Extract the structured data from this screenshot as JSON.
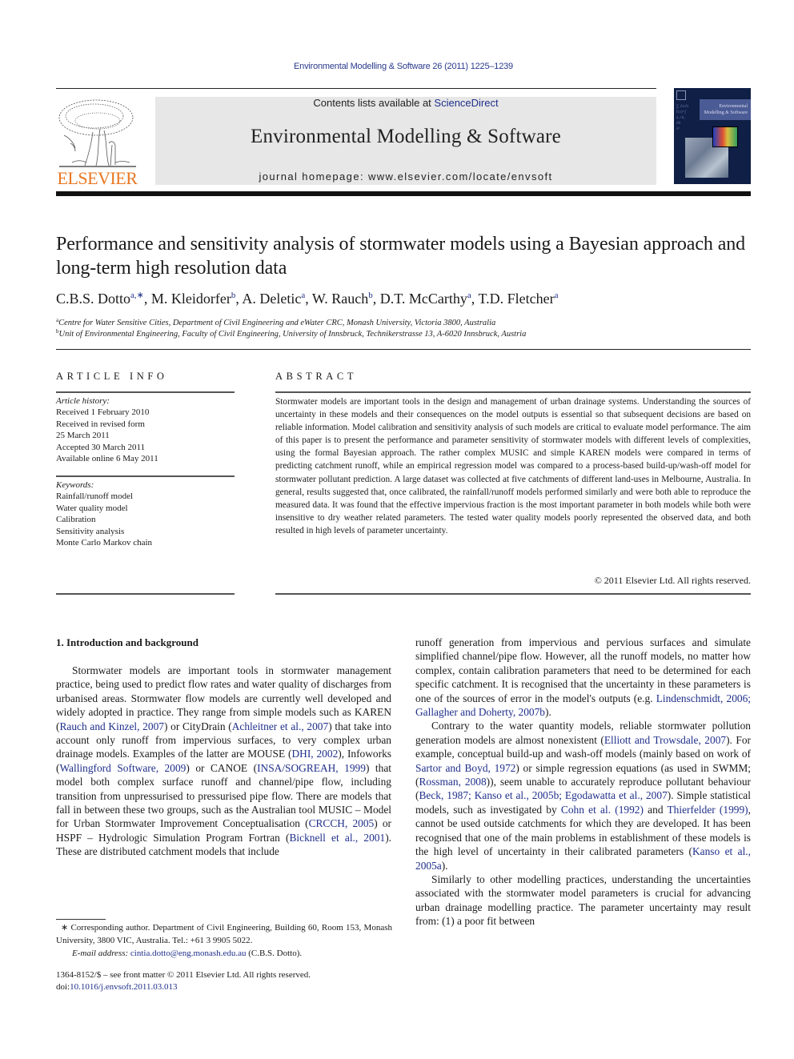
{
  "header": {
    "journal_ref": "Environmental Modelling & Software 26 (2011) 1225–1239",
    "contents_prefix": "Contents lists available at ",
    "contents_link": "ScienceDirect",
    "journal_title": "Environmental Modelling & Software",
    "homepage": "journal homepage: www.elsevier.com/locate/envsoft",
    "publisher_logo_text": "ELSEVIER",
    "cover_title": "Environmental Modelling & Software",
    "colors": {
      "publisher_orange": "#e87722",
      "link_blue": "#1f2f8a",
      "banner_gray": "#e7e7e7",
      "cover_navy": "#0f1f45"
    }
  },
  "article": {
    "title": "Performance and sensitivity analysis of stormwater models using a Bayesian approach and long-term high resolution data",
    "authors": [
      {
        "name": "C.B.S. Dotto",
        "sup": "a,∗"
      },
      {
        "name": "M. Kleidorfer",
        "sup": "b"
      },
      {
        "name": "A. Deletic",
        "sup": "a"
      },
      {
        "name": "W. Rauch",
        "sup": "b"
      },
      {
        "name": "D.T. McCarthy",
        "sup": "a"
      },
      {
        "name": "T.D. Fletcher",
        "sup": "a"
      }
    ],
    "affiliations": [
      {
        "sup": "a",
        "text": "Centre for Water Sensitive Cities, Department of Civil Engineering and eWater CRC, Monash University, Victoria 3800, Australia"
      },
      {
        "sup": "b",
        "text": "Unit of Environmental Engineering, Faculty of Civil Engineering, University of Innsbruck, Technikerstrasse 13, A-6020 Innsbruck, Austria"
      }
    ]
  },
  "article_info": {
    "heading": "ARTICLE INFO",
    "history_label": "Article history:",
    "history": [
      "Received 1 February 2010",
      "Received in revised form",
      "25 March 2011",
      "Accepted 30 March 2011",
      "Available online 6 May 2011"
    ],
    "keywords_label": "Keywords:",
    "keywords": [
      "Rainfall/runoff model",
      "Water quality model",
      "Calibration",
      "Sensitivity analysis",
      "Monte Carlo Markov chain"
    ]
  },
  "abstract": {
    "heading": "ABSTRACT",
    "text": "Stormwater models are important tools in the design and management of urban drainage systems. Understanding the sources of uncertainty in these models and their consequences on the model outputs is essential so that subsequent decisions are based on reliable information. Model calibration and sensitivity analysis of such models are critical to evaluate model performance. The aim of this paper is to present the performance and parameter sensitivity of stormwater models with different levels of complexities, using the formal Bayesian approach. The rather complex MUSIC and simple KAREN models were compared in terms of predicting catchment runoff, while an empirical regression model was compared to a process-based build-up/wash-off model for stormwater pollutant prediction. A large dataset was collected at five catchments of different land-uses in Melbourne, Australia. In general, results suggested that, once calibrated, the rainfall/runoff models performed similarly and were both able to reproduce the measured data. It was found that the effective impervious fraction is the most important parameter in both models while both were insensitive to dry weather related parameters. The tested water quality models poorly represented the observed data, and both resulted in high levels of parameter uncertainty.",
    "copyright": "© 2011 Elsevier Ltd. All rights reserved."
  },
  "body": {
    "section_title": "1.  Introduction and background",
    "left_p1": [
      {
        "t": "Stormwater models are important tools in stormwater management practice, being used to predict flow rates and water quality of discharges from urbanised areas. Stormwater flow models are currently well developed and widely adopted in practice. They range from simple models such as KAREN ("
      },
      {
        "l": "Rauch and Kinzel, 2007"
      },
      {
        "t": ") or CityDrain ("
      },
      {
        "l": "Achleitner et al., 2007"
      },
      {
        "t": ") that take into account only runoff from impervious surfaces, to very complex urban drainage models. Examples of the latter are MOUSE ("
      },
      {
        "l": "DHI, 2002"
      },
      {
        "t": "), Infoworks ("
      },
      {
        "l": "Wallingford Software, 2009"
      },
      {
        "t": ") or CANOE ("
      },
      {
        "l": "INSA/SOGREAH, 1999"
      },
      {
        "t": ") that model both complex surface runoff and channel/pipe flow, including transition from unpressurised to pressurised pipe flow. There are models that fall in between these two groups, such as the Australian tool MUSIC – Model for Urban Stormwater Improvement Conceptualisation ("
      },
      {
        "l": "CRCCH, 2005"
      },
      {
        "t": ") or HSPF – Hydrologic Simulation Program Fortran ("
      },
      {
        "l": "Bicknell et al., 2001"
      },
      {
        "t": "). These are distributed catchment models that include"
      }
    ],
    "right_p0": [
      {
        "t": "runoff generation from impervious and pervious surfaces and simulate simplified channel/pipe flow. However, all the runoff models, no matter how complex, contain calibration parameters that need to be determined for each specific catchment. It is recognised that the uncertainty in these parameters is one of the sources of error in the model's outputs (e.g. "
      },
      {
        "l": "Lindenschmidt, 2006; Gallagher and Doherty, 2007b"
      },
      {
        "t": ")."
      }
    ],
    "right_p1": [
      {
        "t": "Contrary to the water quantity models, reliable stormwater pollution generation models are almost nonexistent ("
      },
      {
        "l": "Elliott and Trowsdale, 2007"
      },
      {
        "t": "). For example, conceptual build-up and wash-off models (mainly based on work of "
      },
      {
        "l": "Sartor and Boyd, 1972"
      },
      {
        "t": ") or simple regression equations (as used in SWMM; ("
      },
      {
        "l": "Rossman, 2008"
      },
      {
        "t": ")), seem unable to accurately reproduce pollutant behaviour ("
      },
      {
        "l": "Beck, 1987; Kanso et al., 2005b; Egodawatta et al., 2007"
      },
      {
        "t": "). Simple statistical models, such as investigated by "
      },
      {
        "l": "Cohn et al. (1992)"
      },
      {
        "t": " and "
      },
      {
        "l": "Thierfelder (1999)"
      },
      {
        "t": ", cannot be used outside catchments for which they are developed. It has been recognised that one of the main problems in establishment of these models is the high level of uncertainty in their calibrated parameters ("
      },
      {
        "l": "Kanso et al., 2005a"
      },
      {
        "t": ")."
      }
    ],
    "right_p2": [
      {
        "t": "Similarly to other modelling practices, understanding the uncertainties associated with the stormwater model parameters is crucial for advancing urban drainage modelling practice. The parameter uncertainty may result from: (1) a poor fit between"
      }
    ]
  },
  "footnote": {
    "corresponding": "∗  Corresponding author. Department of Civil Engineering, Building 60, Room 153, Monash University, 3800 VIC, Australia. Tel.: +61 3 9905 5022.",
    "email_label": "E-mail address: ",
    "email": "cintia.dotto@eng.monash.edu.au",
    "email_suffix": " (C.B.S. Dotto).",
    "issn_line": "1364-8152/$ – see front matter © 2011 Elsevier Ltd. All rights reserved.",
    "doi_prefix": "doi:",
    "doi": "10.1016/j.envsoft.2011.03.013"
  }
}
